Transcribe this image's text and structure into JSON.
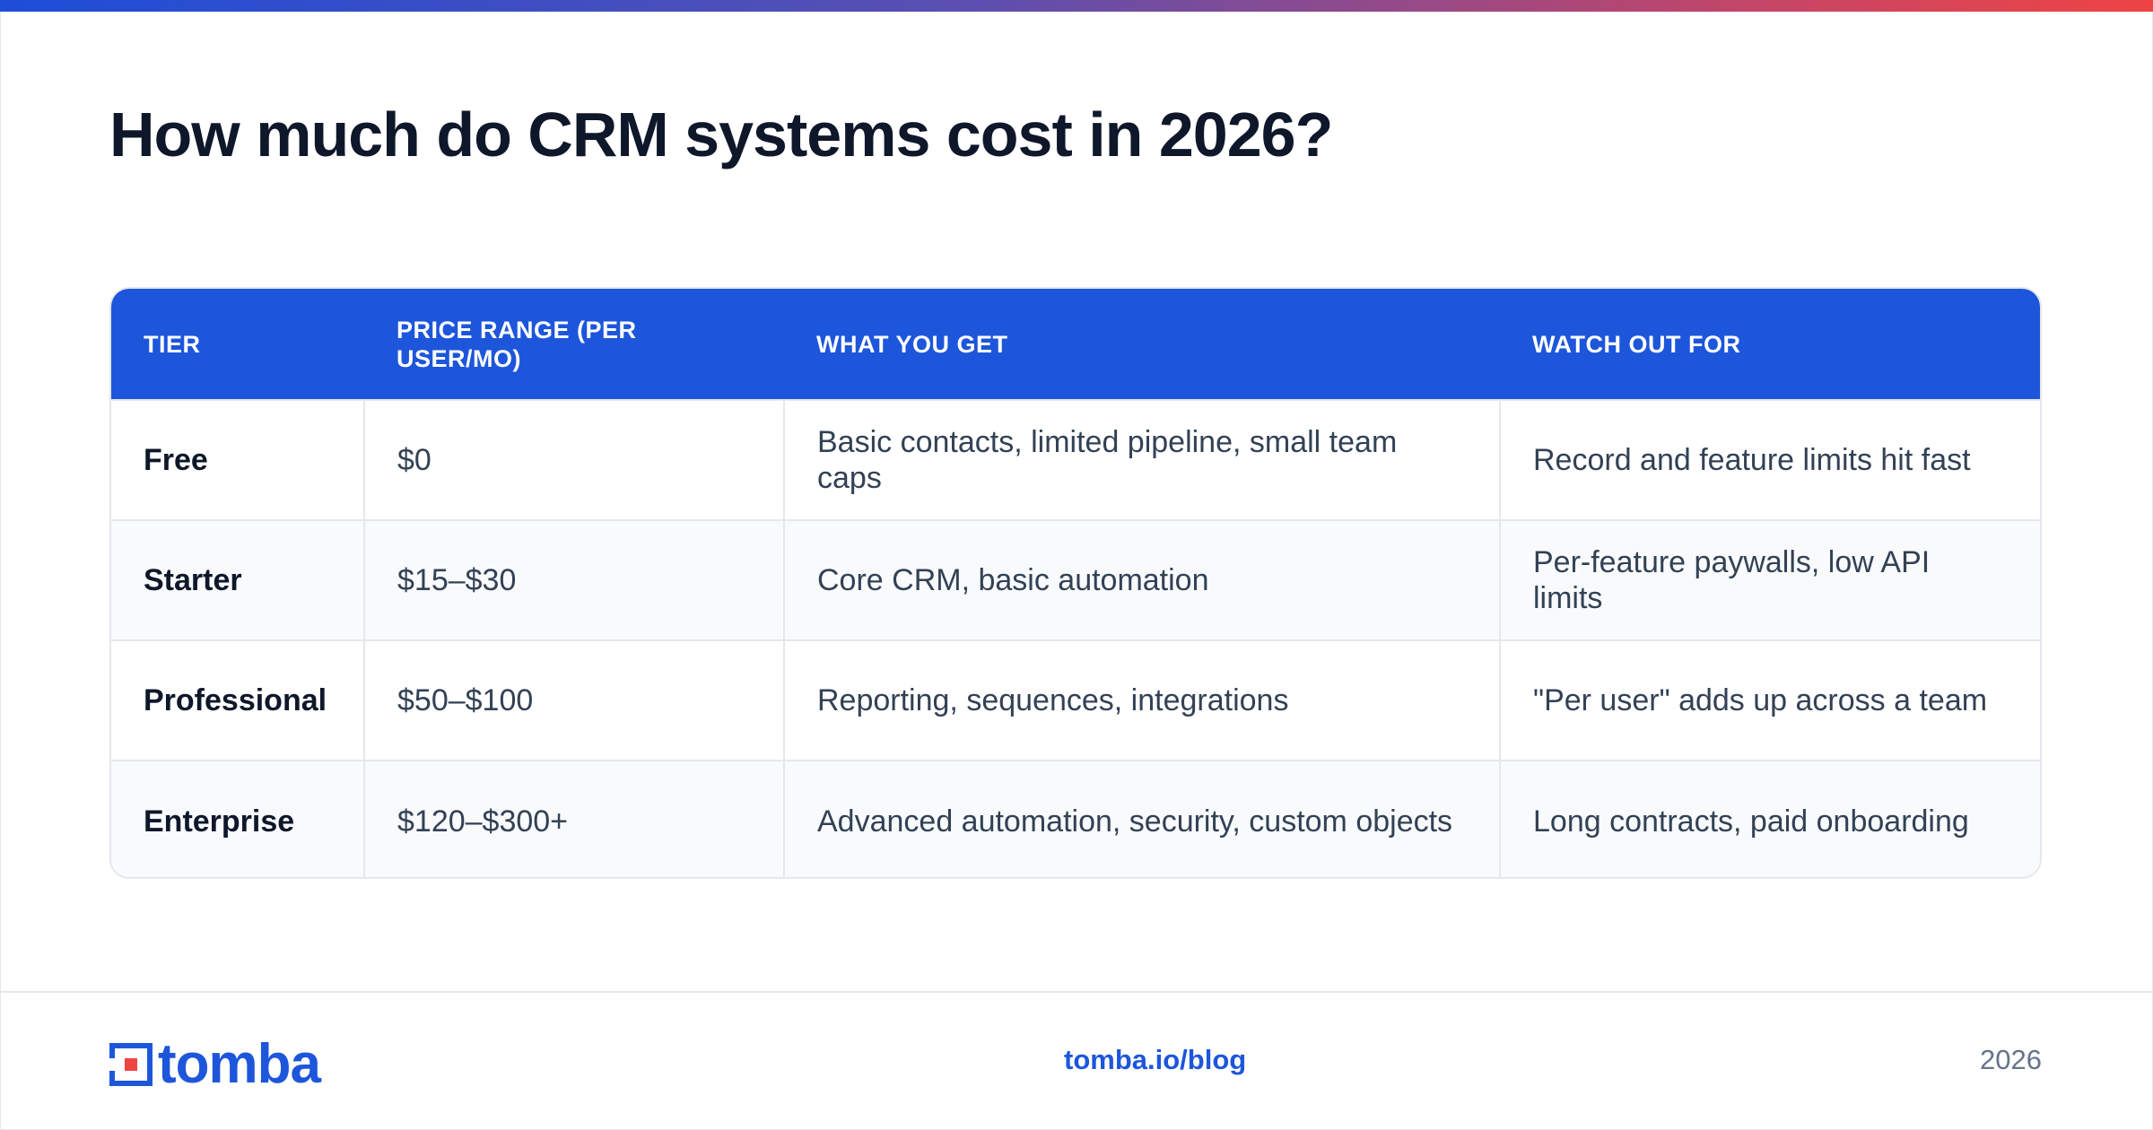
{
  "title": "How much do CRM systems cost in 2026?",
  "table": {
    "headers": [
      "TIER",
      "PRICE RANGE (PER USER/MO)",
      "WHAT YOU GET",
      "WATCH OUT FOR"
    ],
    "rows": [
      [
        "Free",
        "$0",
        "Basic contacts, limited pipeline, small team caps",
        "Record and feature limits hit fast"
      ],
      [
        "Starter",
        "$15–$30",
        "Core CRM, basic automation",
        "Per-feature paywalls, low API limits"
      ],
      [
        "Professional",
        "$50–$100",
        "Reporting, sequences, integrations",
        "\"Per user\" adds up across a team"
      ],
      [
        "Enterprise",
        "$120–$300+",
        "Advanced automation, security, custom objects",
        "Long contracts, paid onboarding"
      ]
    ]
  },
  "footer": {
    "logo_text": "tomba",
    "link": "tomba.io/blog",
    "year": "2026"
  },
  "colors": {
    "accent": "#1d56db",
    "title": "#0f172a",
    "body_text": "#334155",
    "muted": "#64748b",
    "row_alt": "#f8fafc",
    "logo_red": "#ef4444"
  },
  "icons": {
    "logo_mark": "tomba-logo-mark-icon"
  }
}
